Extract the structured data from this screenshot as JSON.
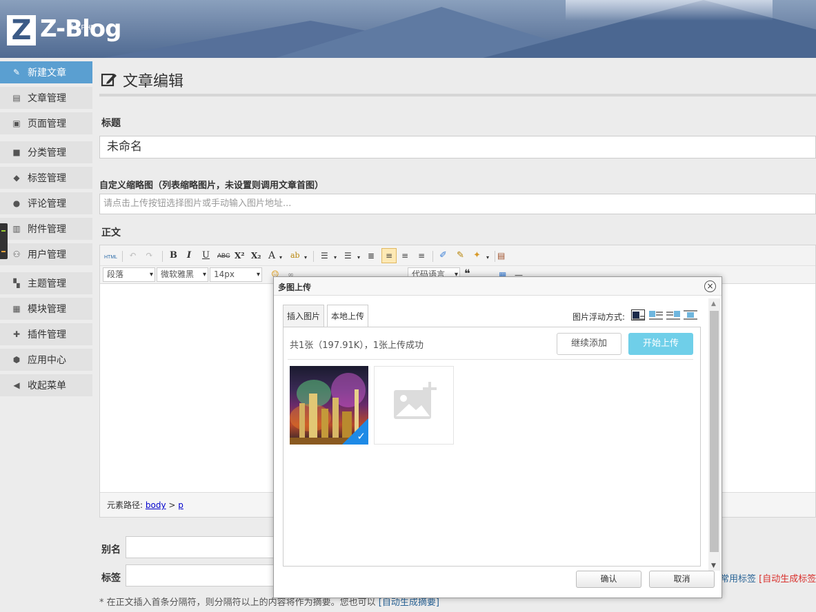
{
  "header": {
    "logo_mark": "Z",
    "logo_text": "Z-Blog",
    "logo_sub": "for PHP"
  },
  "sidebar": {
    "items": [
      {
        "label": "新建文章",
        "icon": "edit-icon",
        "active": true
      },
      {
        "label": "文章管理",
        "icon": "article-icon"
      },
      {
        "label": "页面管理",
        "icon": "page-icon"
      },
      {
        "label": "分类管理",
        "icon": "folder-icon"
      },
      {
        "label": "标签管理",
        "icon": "tag-icon"
      },
      {
        "label": "评论管理",
        "icon": "comment-icon"
      },
      {
        "label": "附件管理",
        "icon": "attachment-icon"
      },
      {
        "label": "用户管理",
        "icon": "users-icon"
      },
      {
        "label": "主题管理",
        "icon": "theme-icon"
      },
      {
        "label": "模块管理",
        "icon": "grid-icon"
      },
      {
        "label": "插件管理",
        "icon": "puzzle-icon"
      },
      {
        "label": "应用中心",
        "icon": "box-icon"
      },
      {
        "label": "收起菜单",
        "icon": "collapse-icon"
      }
    ]
  },
  "main": {
    "page_title": "文章编辑",
    "title_label": "标题",
    "title_value": "未命名",
    "thumb_label": "自定义缩略图（列表缩略图片，未设置则调用文章首图）",
    "thumb_placeholder": "请点击上传按钮选择图片或手动输入图片地址...",
    "body_label": "正文",
    "alias_label": "别名",
    "tags_label": "标签",
    "common_tags": "常用标签",
    "auto_tags": "[自动生成标签]",
    "tip_text": "* 在正文插入首条分隔符，则分隔符以上的内容将作为摘要。您也可以",
    "tip_link": "[自动生成摘要]"
  },
  "editor": {
    "html_btn": "HTML",
    "bold": "B",
    "italic": "I",
    "underline": "U",
    "strike": "ABC",
    "sup": "X²",
    "sub": "X₂",
    "font_color": "A",
    "paragraph_select": "段落",
    "font_family_select": "微软雅黑",
    "font_size_select": "14px",
    "code_lang_select": "代码语言",
    "quote": "❝",
    "path_label": "元素路径:",
    "path_body": "body",
    "path_sep": ">",
    "path_p": "p"
  },
  "dialog": {
    "title": "多图上传",
    "close": "×",
    "tab_insert": "插入图片",
    "tab_local": "本地上传",
    "float_label": "图片浮动方式:",
    "info": "共1张（197.91K），1张上传成功",
    "btn_continue": "继续添加",
    "btn_start": "开始上传",
    "btn_ok": "确认",
    "btn_cancel": "取消"
  }
}
